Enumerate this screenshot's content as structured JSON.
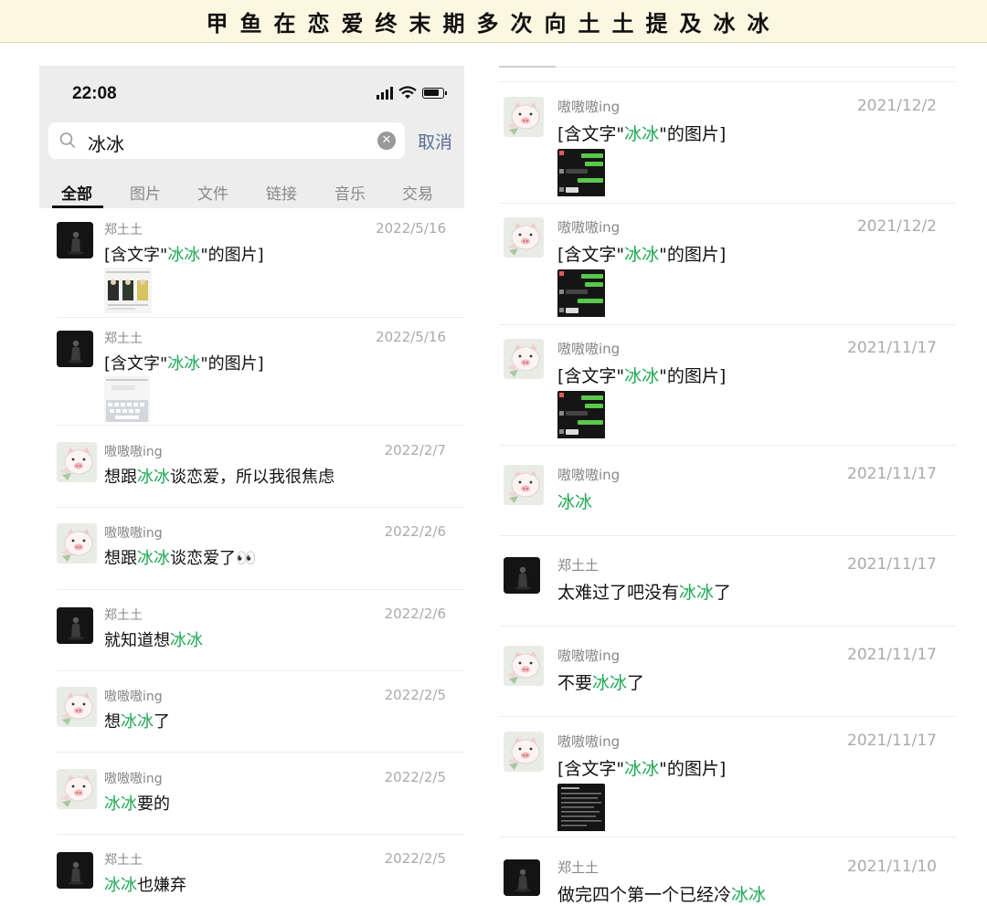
{
  "banner": {
    "title": "甲鱼在恋爱终末期多次向土土提及冰冰"
  },
  "left_panel": {
    "status_time": "22:08",
    "search": {
      "query": "冰冰",
      "cancel_label": "取消"
    },
    "tabs": [
      "全部",
      "图片",
      "文件",
      "链接",
      "音乐",
      "交易"
    ],
    "active_tab": "全部",
    "results": [
      {
        "name": "郑土土",
        "date": "2022/5/16",
        "msg_before": "[含文字\"",
        "keyword": "冰冰",
        "msg_after": "\"的图片]",
        "avatar": "dark-figure-icon",
        "thumb": "photo-thumbnail"
      },
      {
        "name": "郑土土",
        "date": "2022/5/16",
        "msg_before": "[含文字\"",
        "keyword": "冰冰",
        "msg_after": "\"的图片]",
        "avatar": "dark-figure-icon",
        "thumb": "keyboard-screenshot-thumbnail"
      },
      {
        "name": "嗷嗷嗷ing",
        "date": "2022/2/7",
        "msg_before": "想跟",
        "keyword": "冰冰",
        "msg_after": "谈恋爱，所以我很焦虑",
        "avatar": "pig-icon"
      },
      {
        "name": "嗷嗷嗷ing",
        "date": "2022/2/6",
        "msg_before": "想跟",
        "keyword": "冰冰",
        "msg_after": "谈恋爱了👀",
        "avatar": "pig-icon"
      },
      {
        "name": "郑土土",
        "date": "2022/2/6",
        "msg_before": "就知道想",
        "keyword": "冰冰",
        "msg_after": "",
        "avatar": "dark-figure-icon"
      },
      {
        "name": "嗷嗷嗷ing",
        "date": "2022/2/5",
        "msg_before": "想",
        "keyword": "冰冰",
        "msg_after": "了",
        "avatar": "pig-icon"
      },
      {
        "name": "嗷嗷嗷ing",
        "date": "2022/2/5",
        "msg_before": "",
        "keyword": "冰冰",
        "msg_after": "要的",
        "avatar": "pig-icon"
      },
      {
        "name": "郑土土",
        "date": "2022/2/5",
        "msg_before": "",
        "keyword": "冰冰",
        "msg_after": "也嫌弃",
        "avatar": "dark-figure-icon"
      }
    ]
  },
  "right_panel": {
    "results": [
      {
        "name": "嗷嗷嗷ing",
        "date": "2021/12/2",
        "msg_before": "[含文字\"",
        "keyword": "冰冰",
        "msg_after": "\"的图片]",
        "avatar": "pig-icon",
        "thumb": "chat-screenshot-thumbnail"
      },
      {
        "name": "嗷嗷嗷ing",
        "date": "2021/12/2",
        "msg_before": "[含文字\"",
        "keyword": "冰冰",
        "msg_after": "\"的图片]",
        "avatar": "pig-icon",
        "thumb": "chat-screenshot-thumbnail"
      },
      {
        "name": "嗷嗷嗷ing",
        "date": "2021/11/17",
        "msg_before": "[含文字\"",
        "keyword": "冰冰",
        "msg_after": "\"的图片]",
        "avatar": "pig-icon",
        "thumb": "chat-screenshot-thumbnail"
      },
      {
        "name": "嗷嗷嗷ing",
        "date": "2021/11/17",
        "msg_before": "",
        "keyword": "冰冰",
        "msg_after": "",
        "avatar": "pig-icon"
      },
      {
        "name": "郑土土",
        "date": "2021/11/17",
        "msg_before": "太难过了吧没有",
        "keyword": "冰冰",
        "msg_after": "了",
        "avatar": "dark-figure-icon"
      },
      {
        "name": "嗷嗷嗷ing",
        "date": "2021/11/17",
        "msg_before": "不要",
        "keyword": "冰冰",
        "msg_after": "了",
        "avatar": "pig-icon"
      },
      {
        "name": "嗷嗷嗷ing",
        "date": "2021/11/17",
        "msg_before": "[含文字\"",
        "keyword": "冰冰",
        "msg_after": "\"的图片]",
        "avatar": "pig-icon",
        "thumb": "text-screenshot-thumbnail"
      },
      {
        "name": "郑土土",
        "date": "2021/11/10",
        "msg_before": "做完四个第一个已经冷",
        "keyword": "冰冰",
        "msg_after": "",
        "avatar": "dark-figure-icon"
      }
    ]
  },
  "colors": {
    "keyword_highlight": "#20a855",
    "cancel_link": "#5a6f96",
    "banner_bg": "#fbf7e0"
  }
}
